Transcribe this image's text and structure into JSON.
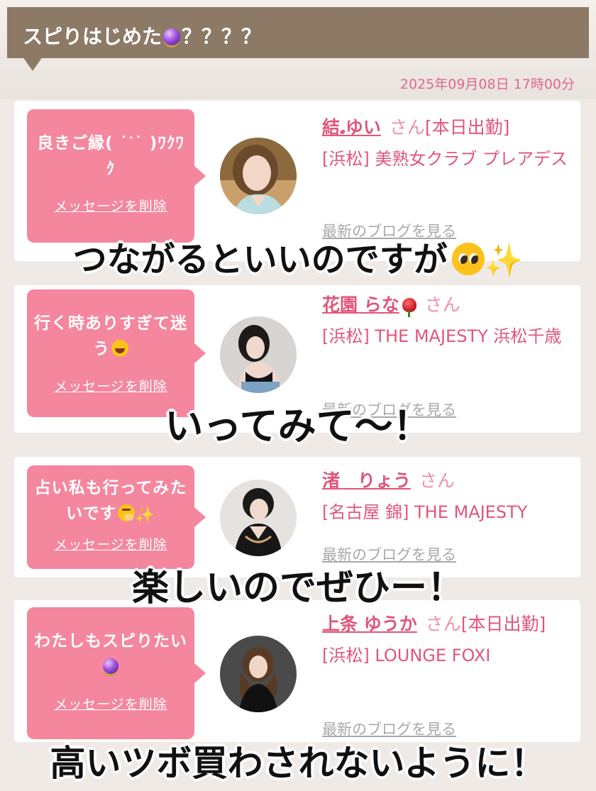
{
  "header": {
    "title": "スピりはじめた",
    "title_suffix": "？？？？",
    "title_icon": "crystal-ball-icon",
    "date": "2025年09月08日 17時00分"
  },
  "colors": {
    "header_bg": "#8c7a66",
    "bubble_bg": "#f4869e",
    "link_pink": "#e0567a",
    "muted_gray": "#a8a8a8"
  },
  "comments": [
    {
      "message": "良きご縁( ˙ᐝ˙ )ﾜｸﾜｸ",
      "delete_label": "メッセージを削除",
      "name": "結𝅘ゆい",
      "san": "さん",
      "tag": "[本日出勤]",
      "shop": "[浜松] 美熟女クラブ プレアデス",
      "blog_label": "最新のブログを見る"
    },
    {
      "message": "行く時ありすぎて迷う",
      "message_icon": "rolling-laughing-icon",
      "delete_label": "メッセージを削除",
      "name": "花園 らな",
      "name_icon": "rose-icon",
      "san": "さん",
      "shop": "[浜松] THE MAJESTY 浜松千歳",
      "blog_label": "最新のブログを見る"
    },
    {
      "message": "占い私も行ってみたいです",
      "message_icons": [
        "shushing-face-icon",
        "sparkles-icon"
      ],
      "delete_label": "メッセージを削除",
      "name": "渚　りょう",
      "san": "さん",
      "shop": "[名古屋 錦] THE MAJESTY",
      "blog_label": "最新のブログを見る"
    },
    {
      "message": "わたしもスピりたい",
      "message_icon": "crystal-ball-icon",
      "delete_label": "メッセージを削除",
      "name": "上条 ゆうか",
      "san": "さん",
      "tag": "[本日出勤]",
      "shop": "[浜松] LOUNGE FOXI",
      "blog_label": "最新のブログを見る"
    }
  ],
  "overlays": [
    {
      "text": "つながるといいのですが",
      "icons": [
        "pleading-face-icon",
        "sparkles-icon"
      ]
    },
    {
      "text": "いってみて〜！"
    },
    {
      "text": "楽しいのでぜひー！"
    },
    {
      "text": "高いツボ買わされないように！"
    }
  ]
}
